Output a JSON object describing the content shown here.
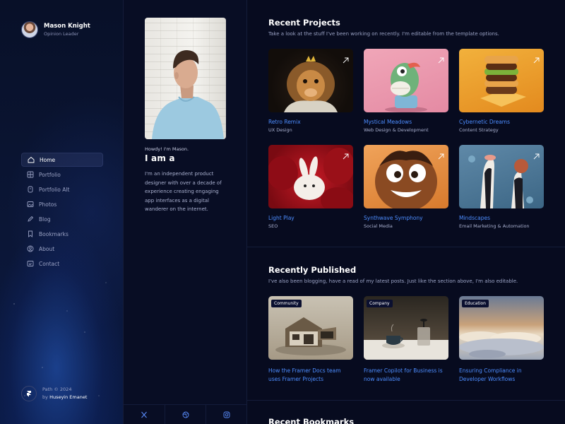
{
  "profile": {
    "name": "Mason Knight",
    "role": "Opinion Leader"
  },
  "nav": {
    "items": [
      {
        "label": "Home",
        "icon": "home-icon",
        "active": true
      },
      {
        "label": "Portfolio",
        "icon": "grid-icon",
        "active": false
      },
      {
        "label": "Portfolio Alt",
        "icon": "file-icon",
        "active": false
      },
      {
        "label": "Photos",
        "icon": "image-icon",
        "active": false
      },
      {
        "label": "Blog",
        "icon": "pen-icon",
        "active": false
      },
      {
        "label": "Bookmarks",
        "icon": "bookmark-icon",
        "active": false
      },
      {
        "label": "About",
        "icon": "user-icon",
        "active": false
      },
      {
        "label": "Contact",
        "icon": "mail-icon",
        "active": false
      }
    ]
  },
  "credit": {
    "line1": "Path © 2024",
    "line2_prefix": "by",
    "author": "Huseyin Emanet"
  },
  "intro": {
    "greeting": "Howdy! I'm Mason.",
    "headline": "I am a",
    "bio": "I'm an independent product designer with over a decade of experience creating engaging app interfaces as a digital wanderer on the internet."
  },
  "socials": [
    {
      "icon": "x-icon"
    },
    {
      "icon": "dribbble-icon"
    },
    {
      "icon": "instagram-icon"
    }
  ],
  "projects": {
    "title": "Recent Projects",
    "subtitle": "Take a look at the stuff I've been working on recently. I'm editable from the template options.",
    "items": [
      {
        "title": "Retro Remix",
        "category": "UX Design"
      },
      {
        "title": "Mystical Meadows",
        "category": "Web Design & Development"
      },
      {
        "title": "Cybernetic Dreams",
        "category": "Content Strategy"
      },
      {
        "title": "Light Play",
        "category": "SEO"
      },
      {
        "title": "Synthwave Symphony",
        "category": "Social Media"
      },
      {
        "title": "Mindscapes",
        "category": "Email Marketing & Automation"
      }
    ]
  },
  "posts": {
    "title": "Recently Published",
    "subtitle": "I've also been blogging, have a read of my latest posts. Just like the section above, I'm also editable.",
    "items": [
      {
        "badge": "Community",
        "title": "How the Framer Docs team uses Framer Projects"
      },
      {
        "badge": "Company",
        "title": "Framer Copilot for Business is now available"
      },
      {
        "badge": "Education",
        "title": "Ensuring Compliance in Developer Workflows"
      }
    ]
  },
  "bookmarks": {
    "title": "Recent Bookmarks"
  },
  "colors": {
    "accent": "#4d8dff",
    "background": "#070b1f",
    "panel": "#080d24"
  }
}
